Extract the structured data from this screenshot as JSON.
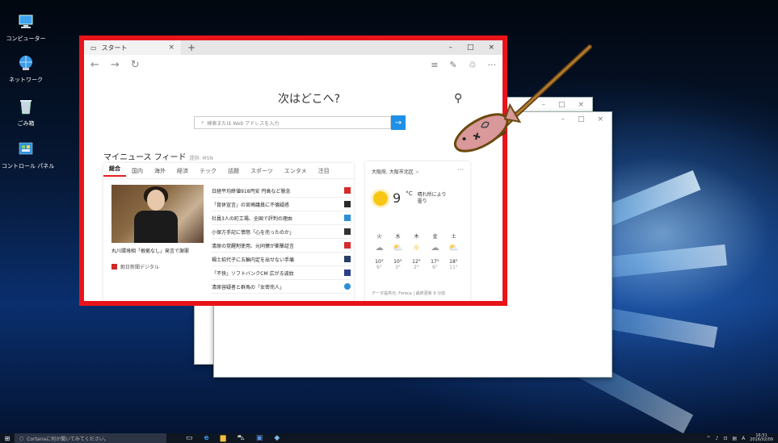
{
  "desktop": {
    "icons": [
      {
        "label": "コンピューター",
        "icon": "computer-icon"
      },
      {
        "label": "ネットワーク",
        "icon": "network-icon"
      },
      {
        "label": "ごみ箱",
        "icon": "recycle-bin-icon"
      },
      {
        "label": "コントロール パネル",
        "icon": "control-panel-icon"
      }
    ]
  },
  "browser": {
    "tab_title": "スタート",
    "new_tab": "+",
    "win_controls": [
      "–",
      "□",
      "×"
    ],
    "hero_title": "次はどこへ?",
    "search_placeholder": "検索または Web アドレスを入力",
    "feed_title": "マイニュース フィード",
    "feed_provider": "提供: MSN",
    "categories": [
      "総合",
      "国内",
      "海外",
      "経済",
      "テック",
      "話題",
      "スポーツ",
      "エンタメ",
      "注目"
    ],
    "feature": {
      "caption": "丸川環境相「根拠なし」発言で謝罪",
      "source": "朝日新聞デジタル"
    },
    "headlines": [
      {
        "text": "日経平均終値918円安 円高など懸念",
        "color": "#d62b2b"
      },
      {
        "text": "「育休宣言」の宮崎議員に不倫疑惑",
        "color": "#2a2a2a"
      },
      {
        "text": "社員3人の町工場、全国で評判の理由",
        "color": "#2b8fd6"
      },
      {
        "text": "小保方手記に憤怒「心を売ったのか」",
        "color": "#333333"
      },
      {
        "text": "清原の覚醒剤使用、元同僚が衝撃証言",
        "color": "#d62b2b"
      },
      {
        "text": "楊士招代子に五輪内定を出せない手痛",
        "color": "#2a3e6a"
      },
      {
        "text": "「不快」ソフトバンクCM 広がる波紋",
        "color": "#2a3e8a"
      },
      {
        "text": "清原容疑者と群馬の「女密売人」",
        "color": "#2b8fd6"
      }
    ],
    "weather": {
      "location": "大阪府, 大阪市北区",
      "location_more": ">",
      "more": "···",
      "temp": "9",
      "unit": "°C",
      "desc_line1": "晴れ所により",
      "desc_line2": "曇り",
      "days": [
        {
          "day": "火",
          "icon": "cloud-icon",
          "hi": "10°",
          "lo": "6°"
        },
        {
          "day": "水",
          "icon": "partly-sunny-icon",
          "hi": "10°",
          "lo": "3°"
        },
        {
          "day": "木",
          "icon": "sun-icon",
          "hi": "12°",
          "lo": "2°"
        },
        {
          "day": "金",
          "icon": "cloud-icon",
          "hi": "17°",
          "lo": "6°"
        },
        {
          "day": "土",
          "icon": "rain-sun-icon",
          "hi": "18°",
          "lo": "11°"
        }
      ],
      "source": "データ提供元: Foreca | 最終更新 9 分前"
    }
  },
  "taskbar": {
    "cortana_placeholder": "Cortanaに何か聞いてみてください。",
    "time": "16:51",
    "date": "2016/02/09",
    "ime": "A"
  }
}
